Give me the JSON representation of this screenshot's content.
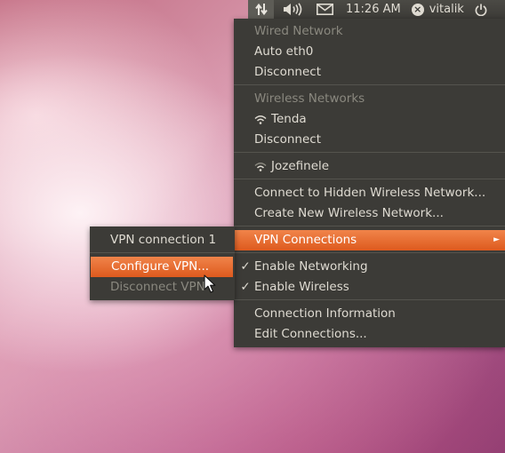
{
  "panel": {
    "clock": "11:26 AM",
    "user": "vitalik",
    "icons": [
      "network-arrows-icon",
      "volume-icon",
      "mail-icon",
      "user-status-icon",
      "power-icon"
    ]
  },
  "network_menu": {
    "wired_header": "Wired Network",
    "auto_eth0": "Auto eth0",
    "wired_disconnect": "Disconnect",
    "wireless_header": "Wireless Networks",
    "tenda": "Tenda",
    "wireless_disconnect": "Disconnect",
    "jozefinele": "Jozefinele",
    "connect_hidden": "Connect to Hidden Wireless Network...",
    "create_new": "Create New Wireless Network...",
    "vpn_connections": "VPN Connections",
    "enable_networking": "Enable Networking",
    "enable_wireless": "Enable Wireless",
    "connection_info": "Connection Information",
    "edit_connections": "Edit Connections...",
    "check_mark": "✓",
    "submenu_arrow": "►"
  },
  "vpn_menu": {
    "vpn_connection_1": "VPN connection 1",
    "configure_vpn": "Configure VPN...",
    "disconnect_vpn": "Disconnect VPN"
  },
  "colors": {
    "panel_bg": "#3c3b37",
    "menu_bg": "#3c3b37",
    "menu_text": "#dfdbd2",
    "disabled_text": "#8a887f",
    "highlight": "#e8662f"
  }
}
